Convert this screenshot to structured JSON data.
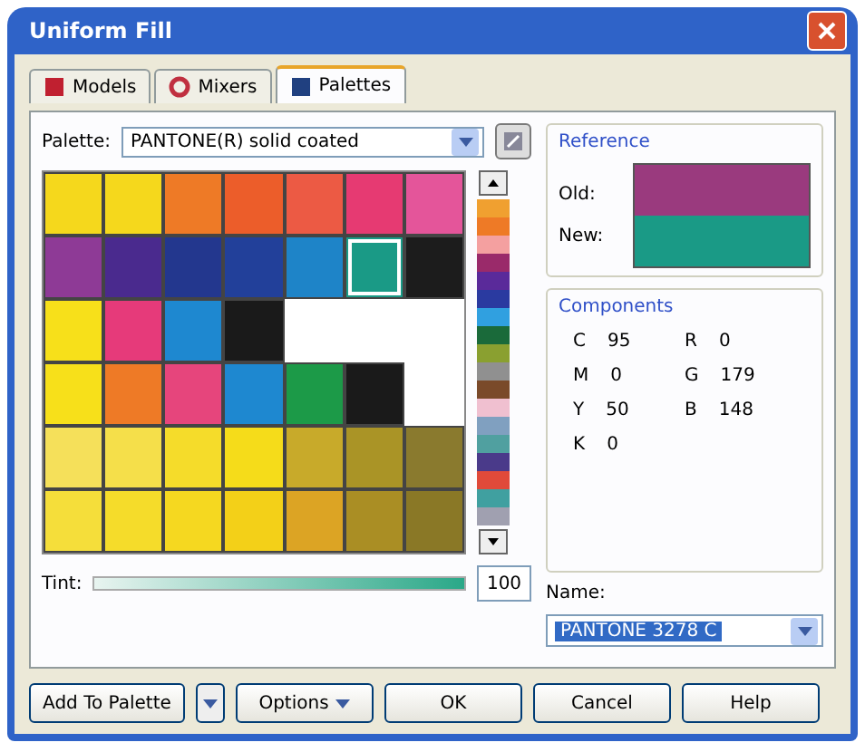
{
  "window": {
    "title": "Uniform Fill"
  },
  "tabs": [
    {
      "label": "Models",
      "selected": false
    },
    {
      "label": "Mixers",
      "selected": false
    },
    {
      "label": "Palettes",
      "selected": true
    }
  ],
  "palette": {
    "label": "Palette:",
    "value": "PANTONE(R) solid coated"
  },
  "swatches": [
    [
      {
        "color": "#f5d81c",
        "selected": false
      },
      {
        "color": "#f5d81c",
        "selected": false
      },
      {
        "color": "#ee7a26",
        "selected": false
      },
      {
        "color": "#ec5d2a",
        "selected": false
      },
      {
        "color": "#ec5a44",
        "selected": false
      },
      {
        "color": "#e63a72",
        "selected": false
      },
      {
        "color": "#e4559a",
        "selected": false
      }
    ],
    [
      {
        "color": "#8e3a96",
        "selected": false
      },
      {
        "color": "#4a2a8e",
        "selected": false
      },
      {
        "color": "#23378e",
        "selected": false
      },
      {
        "color": "#22409a",
        "selected": false
      },
      {
        "color": "#1e84c8",
        "selected": false
      },
      {
        "color": "#1a9a86",
        "selected": true
      },
      {
        "color": "#1c1c1c",
        "selected": false
      }
    ],
    [
      {
        "color": "#f7e01a",
        "selected": false
      },
      {
        "color": "#e63a7a",
        "selected": false
      },
      {
        "color": "#1e88d0",
        "selected": false
      },
      {
        "color": "#1a1a1a",
        "selected": false
      }
    ],
    [
      {
        "color": "#f7e01a",
        "selected": false
      },
      {
        "color": "#ee7a26",
        "selected": false
      },
      {
        "color": "#e6457c",
        "selected": false
      },
      {
        "color": "#1e88d0",
        "selected": false
      },
      {
        "color": "#1c9a48",
        "selected": false
      },
      {
        "color": "#1a1a1a",
        "selected": false
      }
    ],
    [
      {
        "color": "#f5e05a",
        "selected": false
      },
      {
        "color": "#f5df4a",
        "selected": false
      },
      {
        "color": "#f5dc2a",
        "selected": false
      },
      {
        "color": "#f5dc1a",
        "selected": false
      },
      {
        "color": "#c8aa2a",
        "selected": false
      },
      {
        "color": "#aa9426",
        "selected": false
      },
      {
        "color": "#8a7a2e",
        "selected": false
      }
    ],
    [
      {
        "color": "#f5de3a",
        "selected": false
      },
      {
        "color": "#f5dc2a",
        "selected": false
      },
      {
        "color": "#f5d820",
        "selected": false
      },
      {
        "color": "#f3d018",
        "selected": false
      },
      {
        "color": "#dca424",
        "selected": false
      },
      {
        "color": "#aa8e24",
        "selected": false
      },
      {
        "color": "#8a7826",
        "selected": false
      }
    ]
  ],
  "reference": {
    "title": "Reference",
    "previews": [
      {
        "label": "Old:",
        "color": "#9a3a7e"
      },
      {
        "label": "New:",
        "color": "#1a9a86"
      }
    ]
  },
  "components": {
    "title": "Components",
    "cmyk": [
      {
        "label": "C",
        "value": "95"
      },
      {
        "label": "M",
        "value": "0"
      },
      {
        "label": "Y",
        "value": "50"
      },
      {
        "label": "K",
        "value": "0"
      }
    ],
    "rgb": [
      {
        "label": "R",
        "value": "0"
      },
      {
        "label": "G",
        "value": "179"
      },
      {
        "label": "B",
        "value": "148"
      }
    ]
  },
  "tint": {
    "label": "Tint:",
    "level": 1.0,
    "value": "100"
  },
  "name": {
    "label": "Name:",
    "value": "PANTONE 3278 C"
  },
  "buttons": [
    {
      "label": "Add To Palette",
      "kind": "split"
    },
    {
      "label": "Options",
      "kind": "menu"
    },
    {
      "label": "OK",
      "kind": "plain"
    },
    {
      "label": "Cancel",
      "kind": "plain"
    },
    {
      "label": "Help",
      "kind": "plain"
    }
  ]
}
